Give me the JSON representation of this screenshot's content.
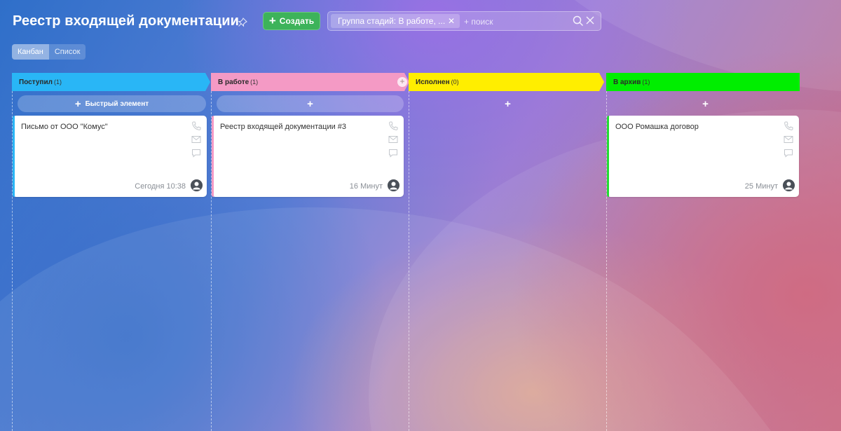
{
  "header": {
    "title": "Реестр входящей документации",
    "create_label": "Создать",
    "filter_chip": "Группа стадий: В работе, ...",
    "search_placeholder": "+ поиск"
  },
  "views": {
    "kanban": "Канбан",
    "list": "Список",
    "active": "Канбан"
  },
  "columns": [
    {
      "name": "Поступил",
      "count": "(1)",
      "color": "#29b6f6",
      "quick_add": "Быстрый элемент",
      "card": {
        "title": "Письмо от ООО \"Комус\"",
        "time": "Сегодня 10:38",
        "stripe": "#29b6f6"
      }
    },
    {
      "name": "В работе",
      "count": "(1)",
      "color": "#f49ac5",
      "quick_add": "",
      "card": {
        "title": "Реестр входящей документации #3",
        "time": "16 Минут",
        "stripe": "#f49ac5"
      }
    },
    {
      "name": "Исполнен",
      "count": "(0)",
      "color": "#ffee00",
      "quick_add": ""
    },
    {
      "name": "В архив",
      "count": "(1)",
      "color": "#00ee00",
      "quick_add": "",
      "card": {
        "title": "ООО Ромашка договор",
        "time": "25 Минут",
        "stripe": "#22dd33"
      }
    }
  ],
  "icons": {
    "pin": "pin-icon",
    "search": "search-icon",
    "clear": "close-icon",
    "phone": "phone-icon",
    "mail": "mail-icon",
    "comment": "comment-icon",
    "avatar": "user-avatar-icon"
  }
}
